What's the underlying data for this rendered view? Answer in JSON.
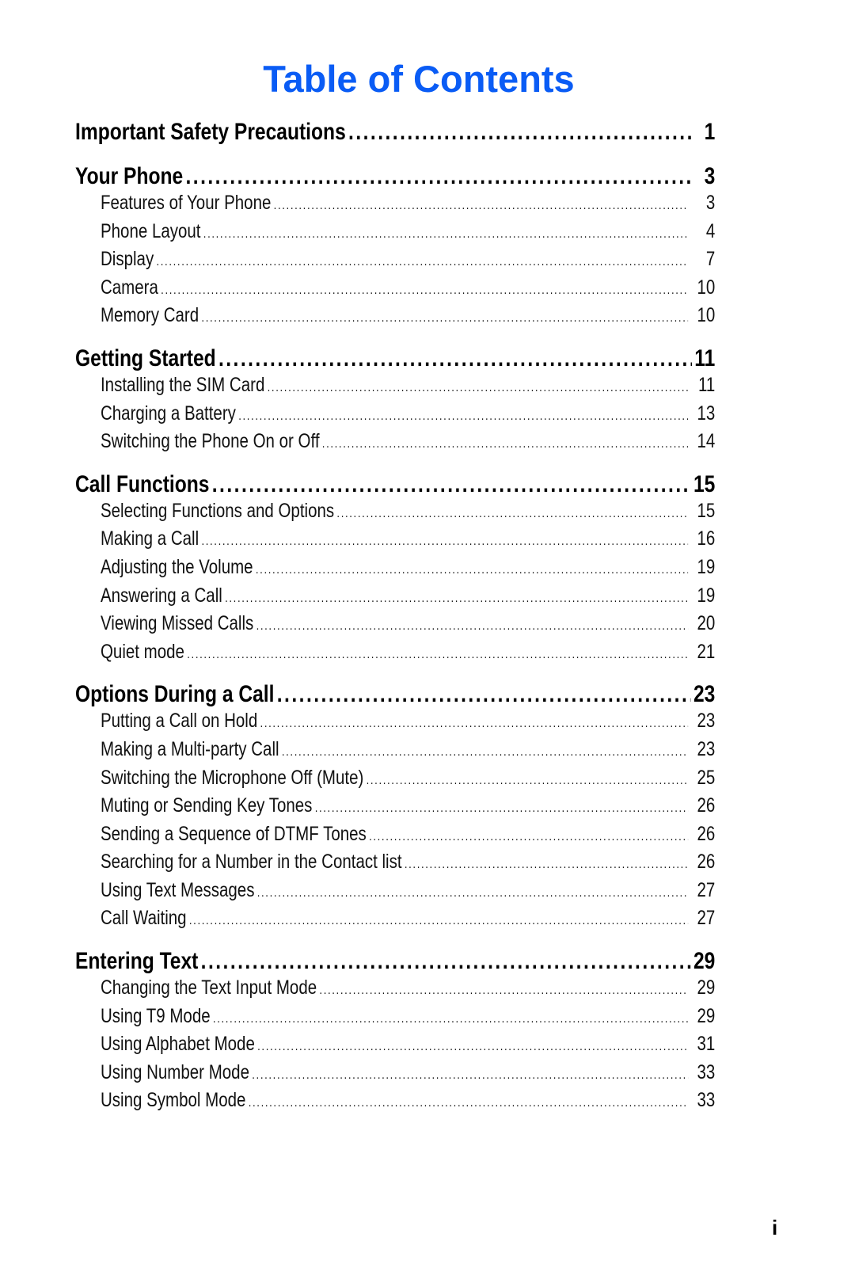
{
  "title": "Table of Contents",
  "title_color": "#0a5cf5",
  "page_number": "i",
  "sections": [
    {
      "title": "Important Safety Precautions",
      "page": "1",
      "items": []
    },
    {
      "title": "Your Phone",
      "page": "3",
      "items": [
        {
          "title": "Features of Your Phone",
          "page": "3"
        },
        {
          "title": "Phone Layout",
          "page": "4"
        },
        {
          "title": "Display",
          "page": "7"
        },
        {
          "title": "Camera",
          "page": "10"
        },
        {
          "title": "Memory Card",
          "page": "10"
        }
      ]
    },
    {
      "title": "Getting Started",
      "page": "11",
      "items": [
        {
          "title": "Installing the SIM Card",
          "page": "11"
        },
        {
          "title": "Charging a Battery",
          "page": "13"
        },
        {
          "title": "Switching the Phone On or Off",
          "page": "14"
        }
      ]
    },
    {
      "title": "Call Functions",
      "page": "15",
      "items": [
        {
          "title": "Selecting Functions and Options",
          "page": "15"
        },
        {
          "title": "Making a Call",
          "page": "16"
        },
        {
          "title": "Adjusting the Volume",
          "page": "19"
        },
        {
          "title": "Answering a Call",
          "page": "19"
        },
        {
          "title": "Viewing Missed Calls",
          "page": "20"
        },
        {
          "title": "Quiet mode",
          "page": "21"
        }
      ]
    },
    {
      "title": "Options During a Call",
      "page": "23",
      "items": [
        {
          "title": "Putting a Call on Hold",
          "page": "23"
        },
        {
          "title": "Making a Multi-party Call",
          "page": "23"
        },
        {
          "title": "Switching the Microphone Off (Mute)",
          "page": "25"
        },
        {
          "title": "Muting or Sending Key Tones",
          "page": "26"
        },
        {
          "title": "Sending a Sequence of DTMF Tones",
          "page": "26"
        },
        {
          "title": "Searching for a Number in the Contact list",
          "page": "26"
        },
        {
          "title": "Using Text Messages",
          "page": "27"
        },
        {
          "title": "Call Waiting",
          "page": "27"
        }
      ]
    },
    {
      "title": "Entering Text",
      "page": "29",
      "items": [
        {
          "title": "Changing the Text Input Mode",
          "page": "29"
        },
        {
          "title": "Using T9 Mode",
          "page": "29"
        },
        {
          "title": "Using Alphabet Mode",
          "page": "31"
        },
        {
          "title": "Using Number Mode",
          "page": "33"
        },
        {
          "title": "Using Symbol Mode",
          "page": "33"
        }
      ]
    }
  ]
}
